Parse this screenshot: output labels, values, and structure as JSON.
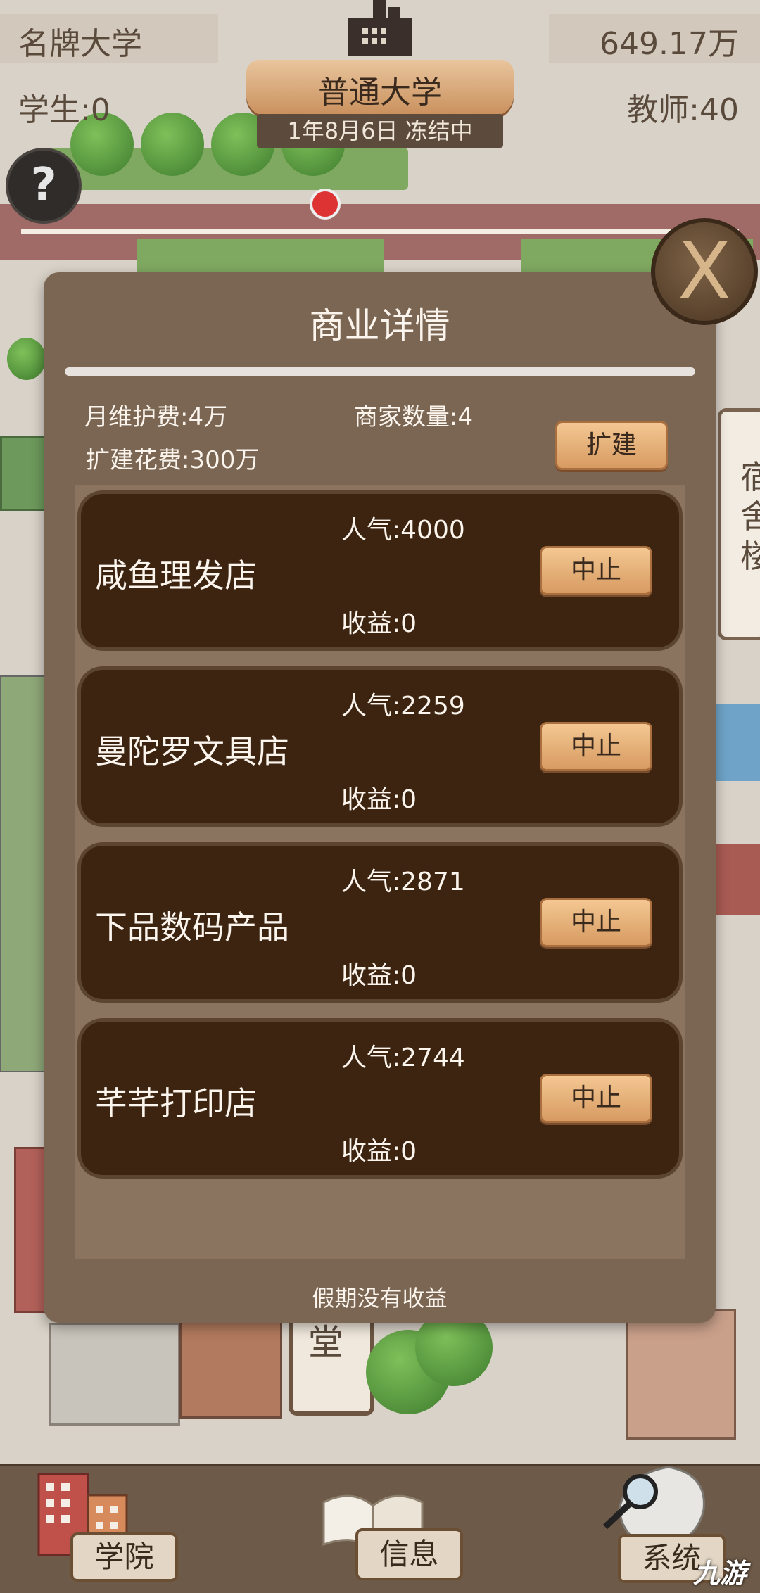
{
  "hud": {
    "school_rank": "名牌大学",
    "money": "649.17万",
    "students": "学生:0",
    "teachers": "教师:40",
    "school_type": "普通大学",
    "date_status": "1年8月6日 冻结中",
    "help_symbol": "?",
    "close_symbol": "X"
  },
  "modal": {
    "title": "商业详情",
    "monthly_fee": "月维护费:4万",
    "merchant_count": "商家数量:4",
    "expand_cost": "扩建花费:300万",
    "expand_button": "扩建",
    "footer_note": "假期没有收益",
    "shops": [
      {
        "name": "咸鱼理发店",
        "popularity": "人气:4000",
        "revenue": "收益:0",
        "button": "中止"
      },
      {
        "name": "曼陀罗文具店",
        "popularity": "人气:2259",
        "revenue": "收益:0",
        "button": "中止"
      },
      {
        "name": "下品数码产品",
        "popularity": "人气:2871",
        "revenue": "收益:0",
        "button": "中止"
      },
      {
        "name": "芊芊打印店",
        "popularity": "人气:2744",
        "revenue": "收益:0",
        "button": "中止"
      }
    ]
  },
  "map_signs": {
    "dorm_sign": "宿舍楼",
    "lower_sign": "堂"
  },
  "nav": {
    "college": "学院",
    "info": "信息",
    "system": "系统"
  },
  "watermark": "九游",
  "colors": {
    "modal_bg": "#7b6653",
    "card_bg": "#3c2410",
    "button_bg": "#e8b47c",
    "text_light": "#fbf5ee"
  },
  "icons": [
    "question-icon",
    "close-icon",
    "factory-icon",
    "building-icon",
    "book-icon",
    "magnifier-icon",
    "watermark-logo-icon"
  ]
}
